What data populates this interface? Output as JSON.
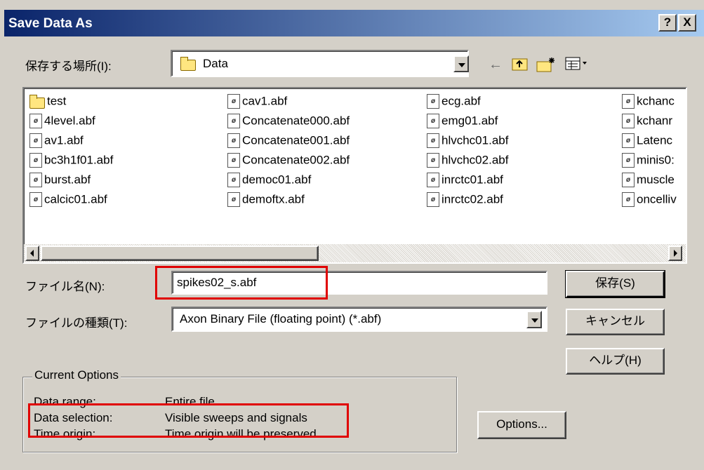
{
  "window": {
    "title": "Save Data As",
    "help_btn": "?",
    "close_btn": "X"
  },
  "location": {
    "label": "保存する場所(I):",
    "value": "Data"
  },
  "files": {
    "col1": [
      "test",
      "4level.abf",
      "av1.abf",
      "bc3h1f01.abf",
      "burst.abf",
      "calcic01.abf"
    ],
    "col2": [
      "cav1.abf",
      "Concatenate000.abf",
      "Concatenate001.abf",
      "Concatenate002.abf",
      "democ01.abf",
      "demoftx.abf"
    ],
    "col3": [
      "ecg.abf",
      "emg01.abf",
      "hlvchc01.abf",
      "hlvchc02.abf",
      "inrctc01.abf",
      "inrctc02.abf"
    ],
    "col4": [
      "kchanc",
      "kchanr",
      "Latenc",
      "minis0:",
      "muscle",
      "oncelliv"
    ]
  },
  "filename": {
    "label": "ファイル名(N):",
    "value": "spikes02_s.abf"
  },
  "filetype": {
    "label": "ファイルの種類(T):",
    "value": "Axon Binary File (floating point) (*.abf)"
  },
  "buttons": {
    "save": "保存(S)",
    "cancel": "キャンセル",
    "help": "ヘルプ(H)",
    "options": "Options..."
  },
  "current_options": {
    "title": "Current Options",
    "rows": [
      {
        "label": "Data range:",
        "value": "Entire file"
      },
      {
        "label": "Data selection:",
        "value": "Visible sweeps and signals"
      },
      {
        "label": "Time origin:",
        "value": "Time origin will be preserved"
      }
    ]
  },
  "colors": {
    "titlebar_start": "#0a246a",
    "titlebar_end": "#a6caf0",
    "highlight_box": "#e00000",
    "dialog_bg": "#d4d0c8"
  },
  "icons": {
    "file": "abf-file-icon",
    "folder": "folder-icon",
    "back": "back-arrow-icon",
    "up": "up-folder-icon",
    "new_folder": "new-folder-icon",
    "view": "view-menu-icon"
  }
}
